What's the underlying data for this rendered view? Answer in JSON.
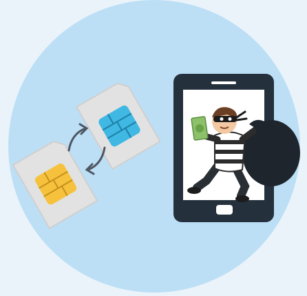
{
  "scene": {
    "subject": "sim-swap-fraud-illustration",
    "colors": {
      "page_bg": "#eaf3f9",
      "circle": "#bcdff6",
      "sim_card": "#e2e2e2",
      "sim_card_edge": "#c9c9c9",
      "chip_blue": "#3fb8e3",
      "chip_yellow": "#f6c23e",
      "arrows": "#4e5660",
      "phone_body": "#24303c",
      "phone_screen": "#ffffff",
      "thief_stripes": "#2c2c2c",
      "money": "#8cc06b",
      "bag": "#1f252d"
    }
  }
}
